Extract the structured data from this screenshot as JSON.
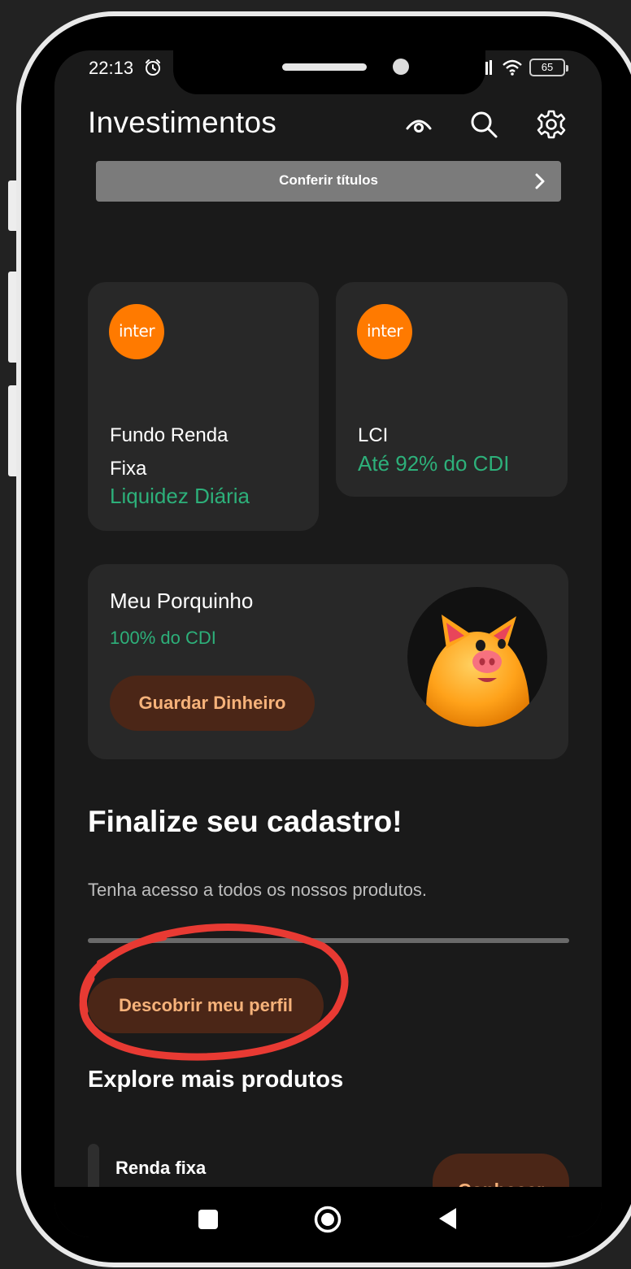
{
  "status_bar": {
    "time": "22:13",
    "battery": "65"
  },
  "header": {
    "title": "Investimentos"
  },
  "banner": {
    "label": "Conferir títulos"
  },
  "products": [
    {
      "logo_text": "inter",
      "name": "Fundo Renda Fixa",
      "highlight": "Liquidez Diária"
    },
    {
      "logo_text": "inter",
      "name": "LCI",
      "highlight": "Até 92% do CDI"
    }
  ],
  "porquinho": {
    "title": "Meu Porquinho",
    "rate": "100% do CDI",
    "button_label": "Guardar Dinheiro"
  },
  "finalize": {
    "title": "Finalize seu cadastro!",
    "description": "Tenha acesso a todos os nossos produtos.",
    "button_label": "Descobrir meu perfil"
  },
  "explore": {
    "title": "Explore mais produtos",
    "item_label": "Renda fixa",
    "button_label": "Conhecer"
  },
  "icons": [
    "alarm-icon",
    "signal-icon",
    "wifi-icon",
    "battery-icon",
    "eye-icon",
    "search-icon",
    "gear-icon",
    "chevron-right-icon",
    "nav-recents-icon",
    "nav-home-icon",
    "nav-back-icon"
  ],
  "colors": {
    "accent_green": "#2db07a",
    "brand_orange": "#ff7a00",
    "button_bg": "#4b2617",
    "button_text": "#f6b27a",
    "highlight_red": "#e83a33"
  }
}
